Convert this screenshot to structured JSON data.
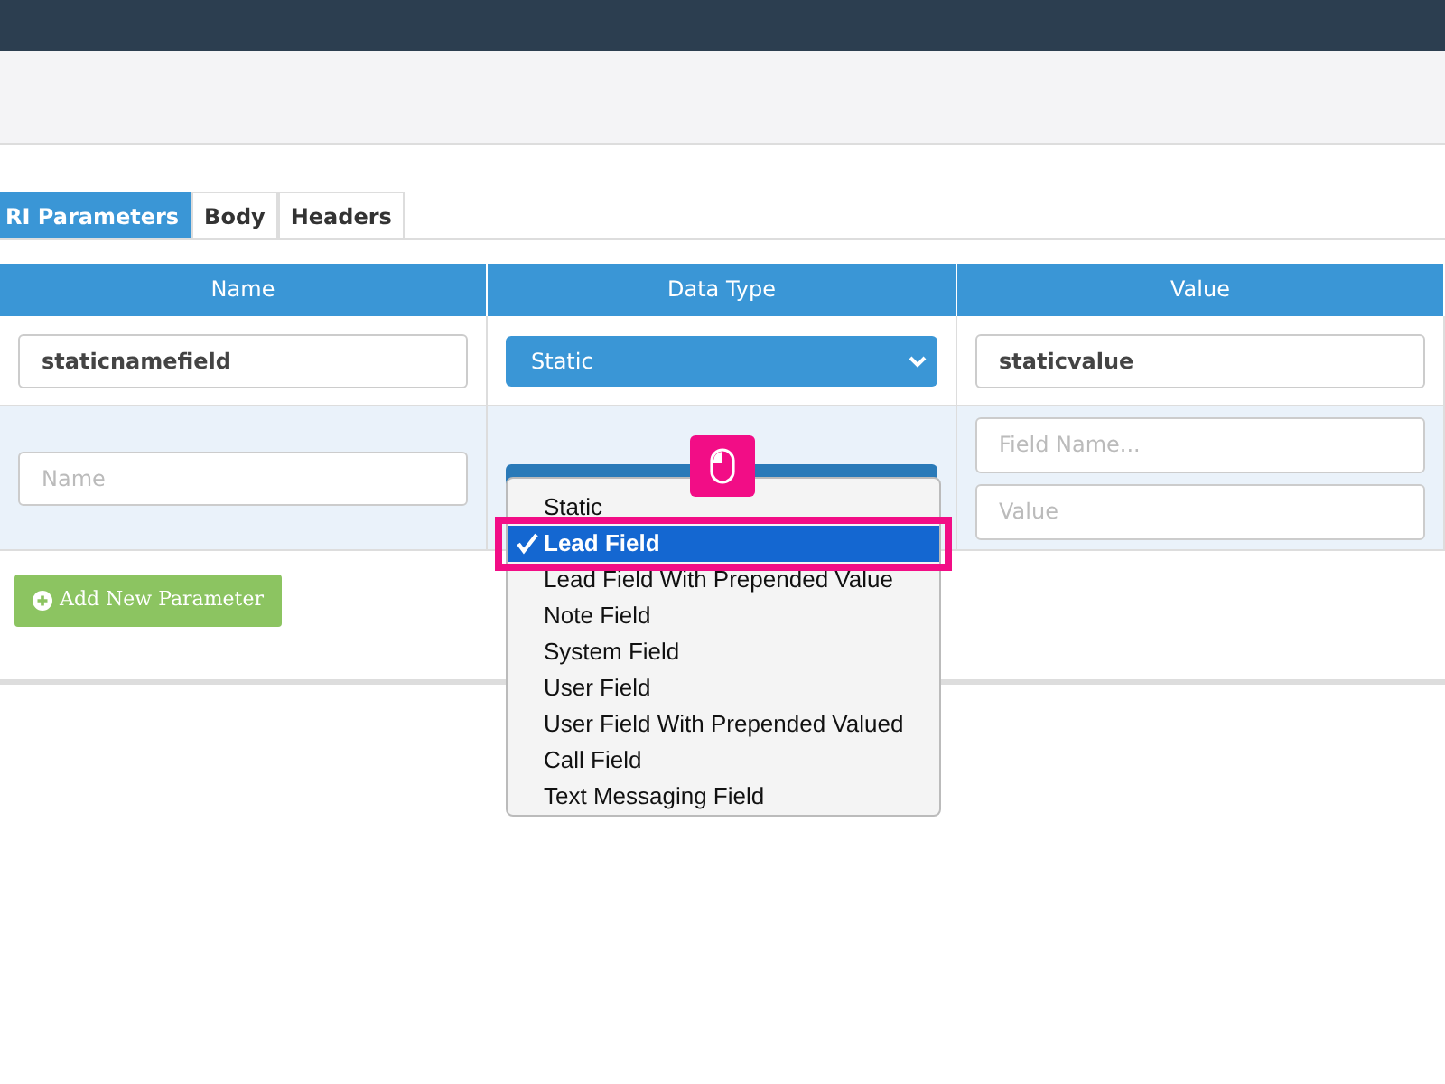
{
  "tabs": [
    {
      "label": "RI Parameters",
      "selected": true
    },
    {
      "label": "Body",
      "selected": false
    },
    {
      "label": "Headers",
      "selected": false
    }
  ],
  "table": {
    "columns": [
      "Name",
      "Data Type",
      "Value"
    ],
    "rows": [
      {
        "name": {
          "value": "staticnamefield"
        },
        "data_type": "Static",
        "value_fields": [
          {
            "value": "staticvalue"
          }
        ]
      },
      {
        "name": {
          "placeholder": "Name"
        },
        "data_type_open": true,
        "value_fields": [
          {
            "placeholder": "Field Name..."
          },
          {
            "placeholder": "Value"
          }
        ]
      }
    ]
  },
  "add_button": "Add New Parameter",
  "dropdown": [
    {
      "label": "Static",
      "selected": false
    },
    {
      "label": "Lead Field",
      "selected": true
    },
    {
      "label": "Lead Field With Prepended Value",
      "selected": false
    },
    {
      "label": "Note Field",
      "selected": false
    },
    {
      "label": "System Field",
      "selected": false
    },
    {
      "label": "User Field",
      "selected": false
    },
    {
      "label": "User Field With Prepended Valued",
      "selected": false
    },
    {
      "label": "Call Field",
      "selected": false
    },
    {
      "label": "Text Messaging Field",
      "selected": false
    }
  ]
}
